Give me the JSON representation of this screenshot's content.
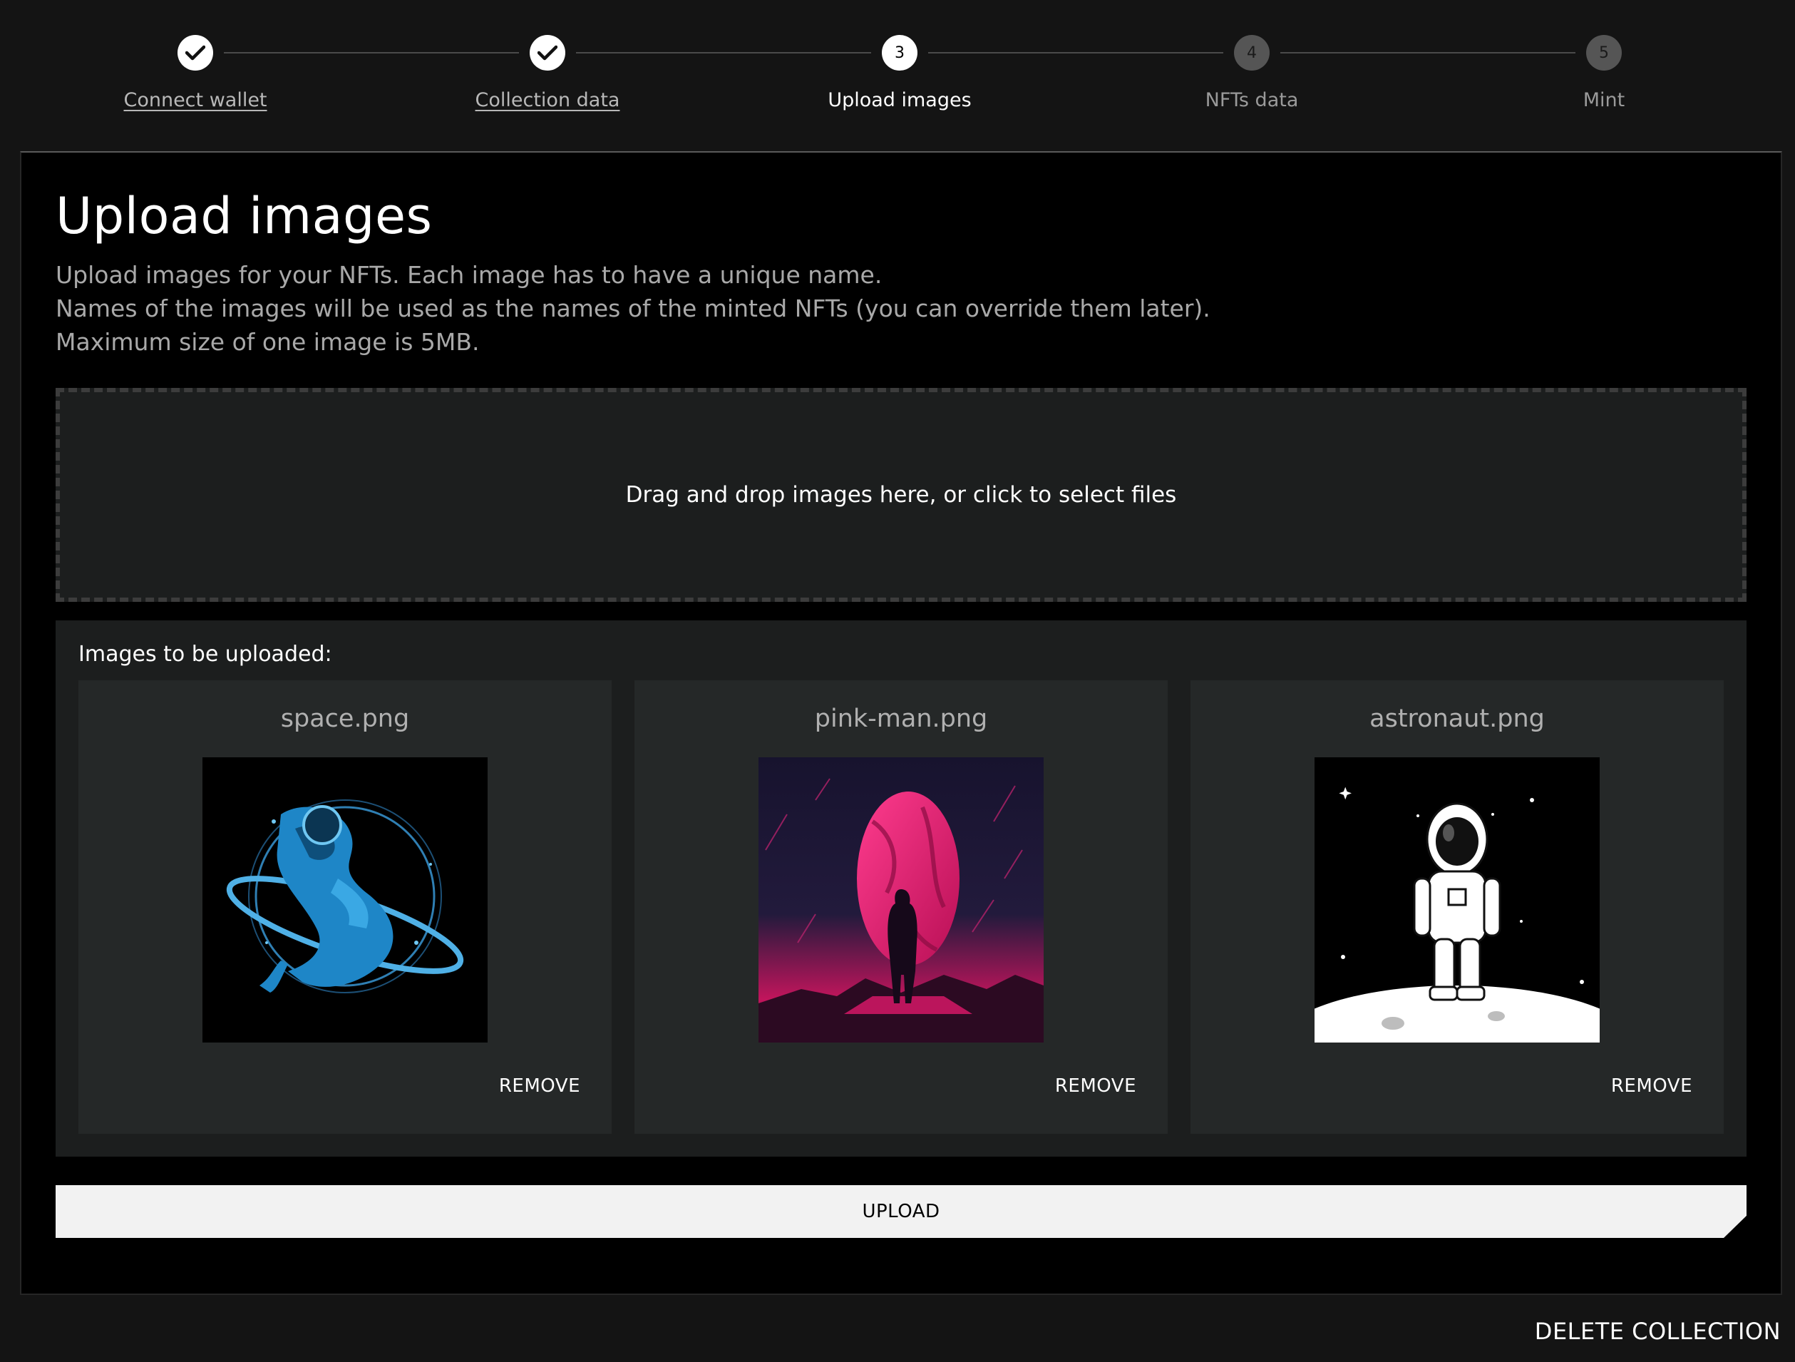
{
  "stepper": {
    "steps": [
      {
        "number": "1",
        "label": "Connect wallet",
        "state": "done"
      },
      {
        "number": "2",
        "label": "Collection data",
        "state": "done"
      },
      {
        "number": "3",
        "label": "Upload images",
        "state": "active"
      },
      {
        "number": "4",
        "label": "NFTs data",
        "state": "pending"
      },
      {
        "number": "5",
        "label": "Mint",
        "state": "pending"
      }
    ]
  },
  "main": {
    "title": "Upload images",
    "description": [
      "Upload images for your NFTs. Each image has to have a unique name.",
      "Names of the images will be used as the names of the minted NFTs (you can override them later).",
      "Maximum size of one image is 5MB."
    ],
    "dropzone_text": "Drag and drop images here, or click to select files",
    "images_heading": "Images to be uploaded:",
    "images": [
      {
        "name": "space.png",
        "remove_label": "REMOVE"
      },
      {
        "name": "pink-man.png",
        "remove_label": "REMOVE"
      },
      {
        "name": "astronaut.png",
        "remove_label": "REMOVE"
      }
    ],
    "upload_label": "UPLOAD"
  },
  "footer": {
    "delete_label": "DELETE COLLECTION"
  },
  "colors": {
    "background": "#141414",
    "panel": "#000000",
    "card": "#252828",
    "section": "#1c1e1e",
    "upload_button": "#f2f2f2"
  }
}
